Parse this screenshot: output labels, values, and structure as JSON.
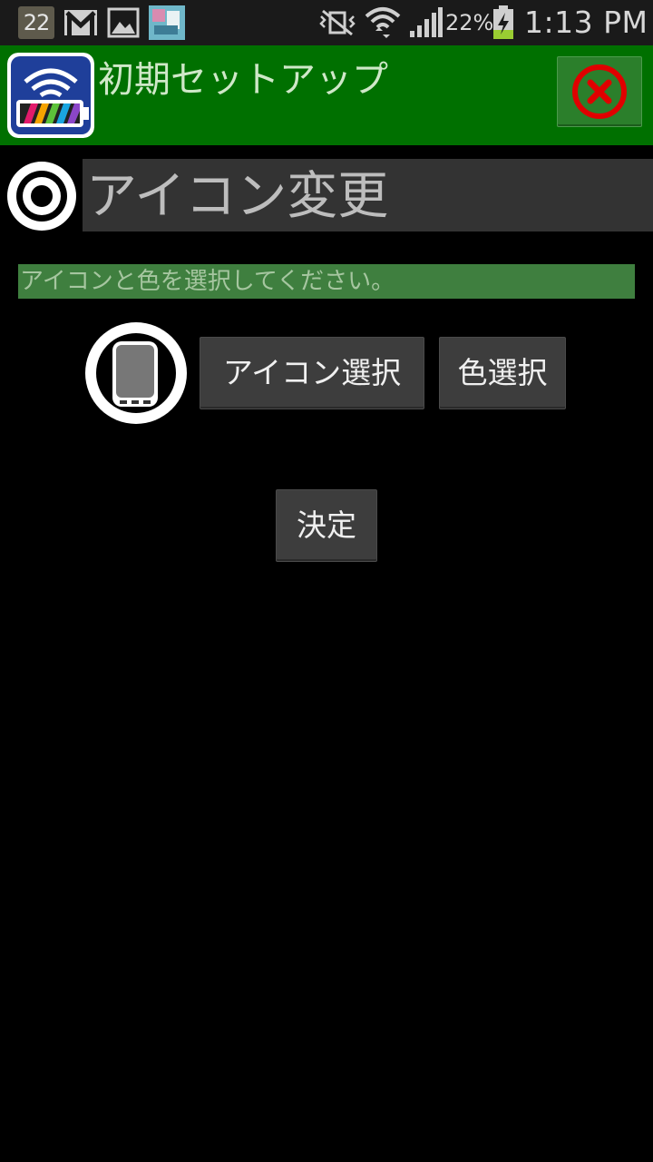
{
  "status_bar": {
    "notification_count": "22",
    "battery_percent": "22%",
    "time": "1:13 PM",
    "icons": [
      "gmail-icon",
      "image-icon",
      "app-thumbnail-icon",
      "vibrate-mute-icon",
      "wifi-icon",
      "signal-icon",
      "battery-charging-icon"
    ]
  },
  "header": {
    "title": "初期セットアップ",
    "logo_icon": "wifi-battery-app-icon",
    "close_icon": "close-circle-icon",
    "background_color": "#007000"
  },
  "section": {
    "icon": "target-circle-icon",
    "title": "アイコン変更"
  },
  "instruction": {
    "text": "アイコンと色を選択してください。"
  },
  "icon_selector": {
    "preview_icon": "smartphone-icon",
    "icon_select_label": "アイコン選択",
    "color_select_label": "色選択"
  },
  "actions": {
    "confirm_label": "決定"
  },
  "colors": {
    "accent_green": "#007000",
    "instruction_bg": "#3f7f3f",
    "button_bg": "#3d3d3d",
    "close_red": "#e00000"
  }
}
